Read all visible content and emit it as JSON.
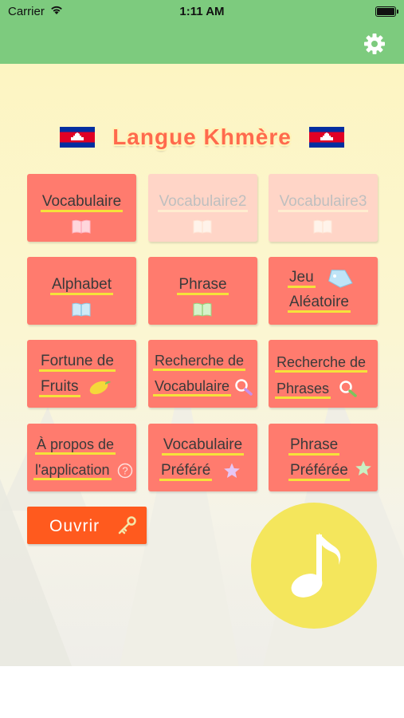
{
  "status_bar": {
    "carrier": "Carrier",
    "time": "1:11 AM"
  },
  "navbar": {
    "settings_icon": "gear-icon",
    "color": "#7dcb7e"
  },
  "title": {
    "text": "Langue Khmère",
    "flag_icon": "cambodia-flag-icon"
  },
  "tiles": [
    {
      "lines": [
        "Vocabulaire"
      ],
      "icon": "book-icon",
      "enabled": true
    },
    {
      "lines": [
        "Vocabulaire2"
      ],
      "icon": "book-icon",
      "enabled": false
    },
    {
      "lines": [
        "Vocabulaire3"
      ],
      "icon": "book-icon",
      "enabled": false
    },
    {
      "lines": [
        "Alphabet"
      ],
      "icon": "book-icon",
      "enabled": true
    },
    {
      "lines": [
        "Phrase"
      ],
      "icon": "book-icon",
      "enabled": true
    },
    {
      "lines": [
        "Jeu",
        "Aléatoire"
      ],
      "icon": "tag-icon",
      "enabled": true
    },
    {
      "lines": [
        "Fortune de",
        "Fruits"
      ],
      "icon": "mango-icon",
      "enabled": true
    },
    {
      "lines": [
        "Recherche de",
        "Vocabulaire"
      ],
      "icon": "search-icon",
      "enabled": true
    },
    {
      "lines": [
        "Recherche de",
        "Phrases"
      ],
      "icon": "search-icon",
      "enabled": true
    },
    {
      "lines": [
        "À propos de",
        "l'application"
      ],
      "icon": "help-icon",
      "enabled": true
    },
    {
      "lines": [
        "Vocabulaire",
        "Préféré"
      ],
      "icon": "star-icon",
      "enabled": true
    },
    {
      "lines": [
        "Phrase",
        "Préférée"
      ],
      "icon": "star-icon",
      "enabled": true
    }
  ],
  "open_button": {
    "label": "Ouvrir",
    "icon": "key-icon"
  },
  "music_button": {
    "icon": "music-note-icon"
  },
  "colors": {
    "tile": "#ff7b6e",
    "tile_disabled": "#ffd5c7",
    "underline": "#f5e23a",
    "open_button": "#ff5a1e",
    "music_circle": "#f4e65c"
  }
}
